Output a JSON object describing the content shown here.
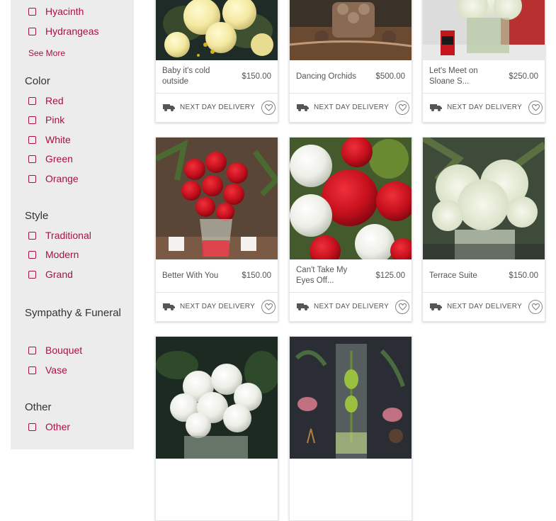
{
  "sidebar": {
    "type_items": [
      {
        "label": "Hyacinth"
      },
      {
        "label": "Hydrangeas"
      }
    ],
    "see_more": "See More",
    "color": {
      "heading": "Color",
      "items": [
        {
          "label": "Red"
        },
        {
          "label": "Pink"
        },
        {
          "label": "White"
        },
        {
          "label": "Green"
        },
        {
          "label": "Orange"
        }
      ]
    },
    "style": {
      "heading": "Style",
      "items": [
        {
          "label": "Traditional"
        },
        {
          "label": "Modern"
        },
        {
          "label": "Grand"
        }
      ]
    },
    "sympathy": {
      "heading": "Sympathy & Funeral",
      "items": [
        {
          "label": "Bouquet"
        },
        {
          "label": "Vase"
        }
      ]
    },
    "other": {
      "heading": "Other",
      "items": [
        {
          "label": "Other"
        }
      ]
    }
  },
  "products": [
    {
      "name": "Baby it's cold outside",
      "price": "$150.00",
      "delivery": "NEXT DAY DELIVERY",
      "image": "yellow-roses-arrangement"
    },
    {
      "name": "Dancing Orchids",
      "price": "$500.00",
      "delivery": "NEXT DAY DELIVERY",
      "image": "orchid-arrangement"
    },
    {
      "name": "Let's Meet on Sloane S...",
      "price": "$250.00",
      "delivery": "NEXT DAY DELIVERY",
      "image": "white-flowers-phone-box"
    },
    {
      "name": "Better With You",
      "price": "$150.00",
      "delivery": "NEXT DAY DELIVERY",
      "image": "red-roses-vase"
    },
    {
      "name": "Can't Take My Eyes Off...",
      "price": "$125.00",
      "delivery": "NEXT DAY DELIVERY",
      "image": "red-roses-hydrangea"
    },
    {
      "name": "Terrace Suite",
      "price": "$150.00",
      "delivery": "NEXT DAY DELIVERY",
      "image": "white-hydrangea-cube"
    },
    {
      "name": "",
      "price": "",
      "delivery": "",
      "image": "white-roses-vase"
    },
    {
      "name": "",
      "price": "",
      "delivery": "",
      "image": "green-orchid-cylinder"
    }
  ],
  "colors": {
    "accent": "#a8123e",
    "sidebar_bg": "#ececec",
    "text": "#555555"
  }
}
